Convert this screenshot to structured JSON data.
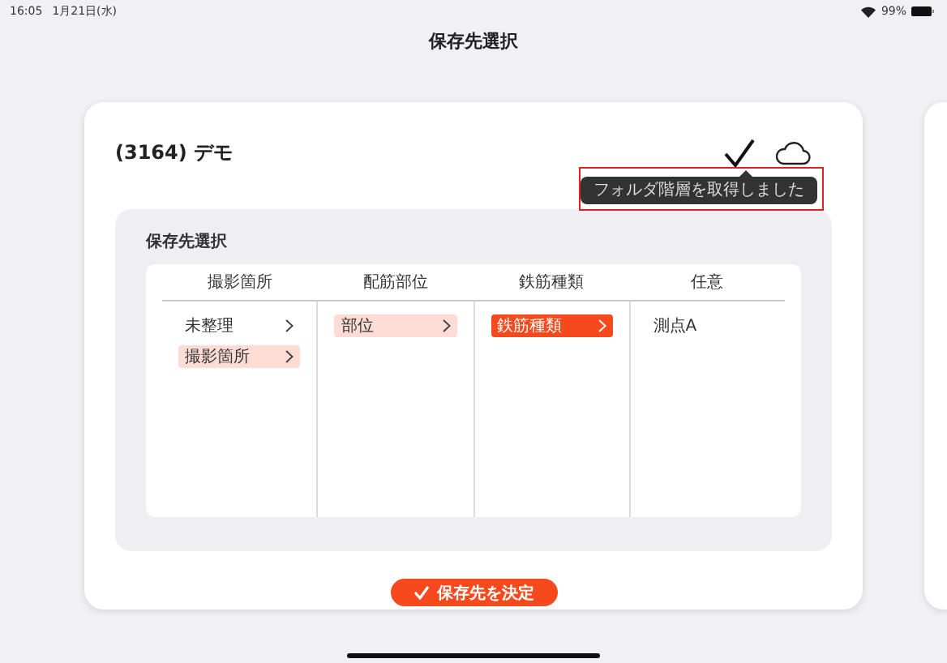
{
  "status_bar": {
    "time": "16:05",
    "date": "1月21日(水)",
    "battery": "99%"
  },
  "nav_title": "保存先選択",
  "card": {
    "title": "(3164) デモ",
    "tooltip": "フォルダ階層を取得しました",
    "tooltip_highlighted": true
  },
  "panel": {
    "label": "保存先選択",
    "columns": [
      {
        "heading": "撮影箇所",
        "items": [
          {
            "label": "未整理",
            "kind": "folder",
            "selected": false,
            "current": false
          },
          {
            "label": "撮影箇所",
            "kind": "folder",
            "selected": true,
            "current": false
          }
        ]
      },
      {
        "heading": "配筋部位",
        "items": [
          {
            "label": "部位",
            "kind": "folder",
            "selected": true,
            "current": false
          }
        ]
      },
      {
        "heading": "鉄筋種類",
        "items": [
          {
            "label": "鉄筋種類",
            "kind": "folder",
            "selected": true,
            "current": true
          }
        ]
      },
      {
        "heading": "任意",
        "items": [
          {
            "label": "測点A",
            "kind": "leaf",
            "selected": false,
            "current": false
          }
        ]
      }
    ]
  },
  "confirm_button": "保存先を決定"
}
